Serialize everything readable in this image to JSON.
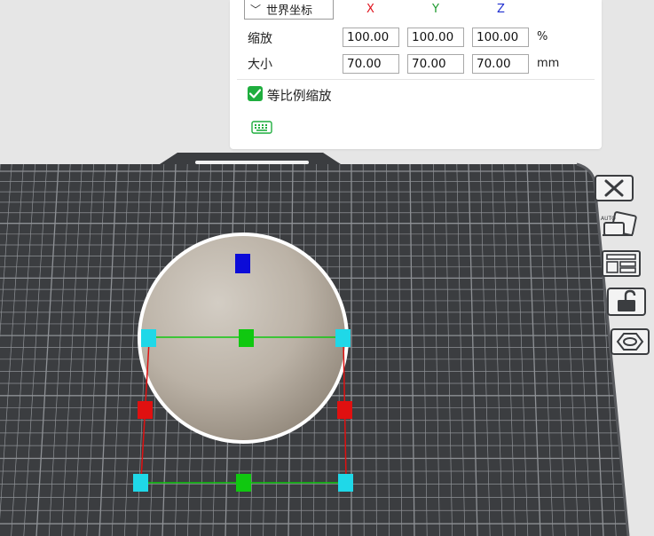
{
  "scale_panel": {
    "coord_system": "世界坐标",
    "axes": {
      "x": "X",
      "y": "Y",
      "z": "Z"
    },
    "axis_colors": {
      "x": "#e0141e",
      "y": "#1d9a2e",
      "z": "#1f2fd0"
    },
    "scale": {
      "label": "缩放",
      "x": "100.00",
      "y": "100.00",
      "z": "100.00",
      "unit": "%"
    },
    "size": {
      "label": "大小",
      "x": "70.00",
      "y": "70.00",
      "z": "70.00",
      "unit": "mm"
    },
    "uniform_scale": {
      "label": "等比例缩放",
      "checked": true
    },
    "keyboard_icon": "keyboard-icon"
  },
  "toolbar": {
    "icons": [
      "close-icon",
      "auto-arrange-icon",
      "layout-icon",
      "lock-icon",
      "hexagon-icon"
    ]
  },
  "colors": {
    "plate": "#3b3d40",
    "grid_line": "#8e9195",
    "accent_green": "#1fae3e",
    "handle_cyan": "#1fd8e8",
    "handle_red": "#e01010",
    "handle_green": "#10c810",
    "handle_blue": "#0b0bd8"
  }
}
